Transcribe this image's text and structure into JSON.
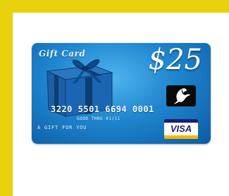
{
  "card": {
    "title": "Gift Card",
    "amount": "$25",
    "number": "3220 5501 6694 0001",
    "good_thru": "GOOD THRU 01/11",
    "tagline": "A GIFT FOR YOU",
    "brand": "VISA"
  },
  "colors": {
    "background": "#e8d20e",
    "card_blue": "#1f86cf",
    "visa_blue": "#1a1f71",
    "visa_gold": "#f7b600"
  },
  "icons": [
    "gift-box-icon",
    "dove-logo-icon",
    "visa-logo"
  ]
}
